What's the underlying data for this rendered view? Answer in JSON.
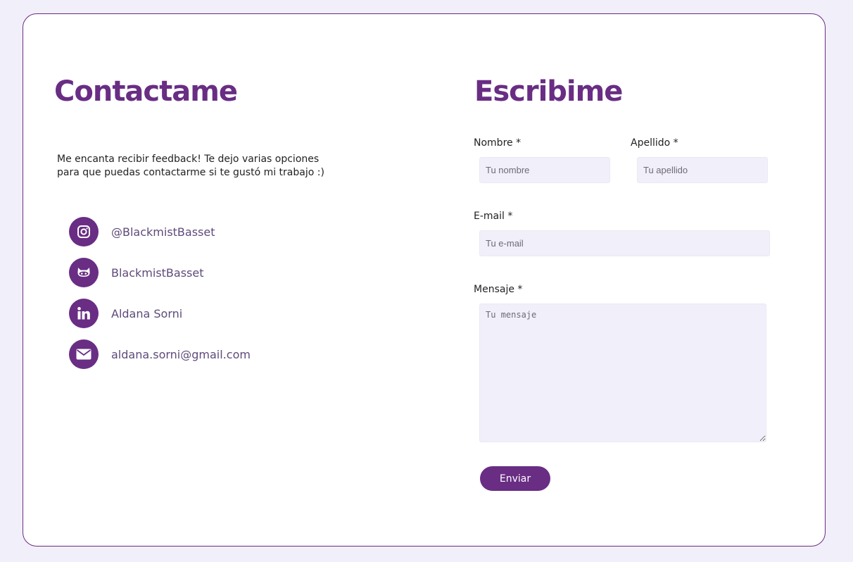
{
  "contact": {
    "title": "Contactame",
    "intro_line1": "Me encanta recibir feedback! Te dejo varias opciones",
    "intro_line2": "para que puedas contactarme si te gustó mi trabajo :)",
    "items": [
      {
        "icon": "instagram-icon",
        "label": "@BlackmistBasset"
      },
      {
        "icon": "github-icon",
        "label": "BlackmistBasset"
      },
      {
        "icon": "linkedin-icon",
        "label": "Aldana Sorni"
      },
      {
        "icon": "email-icon",
        "label": "aldana.sorni@gmail.com"
      }
    ]
  },
  "form": {
    "title": "Escribime",
    "nombre_label": "Nombre *",
    "nombre_placeholder": "Tu nombre",
    "apellido_label": "Apellido *",
    "apellido_placeholder": "Tu apellido",
    "email_label": "E-mail *",
    "email_placeholder": "Tu e-mail",
    "mensaje_label": "Mensaje *",
    "mensaje_placeholder": "Tu mensaje",
    "submit_label": "Enviar"
  },
  "colors": {
    "accent": "#692d84",
    "background": "#f1eff9",
    "input_bg": "#f1eff9"
  }
}
